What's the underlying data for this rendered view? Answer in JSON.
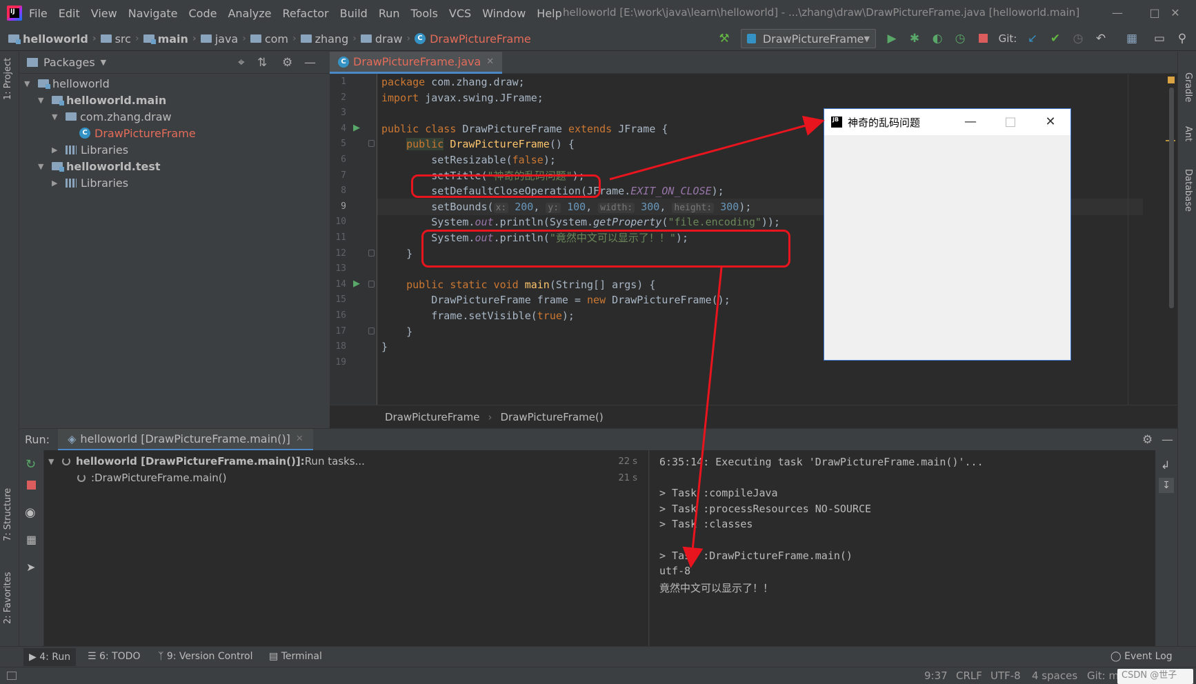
{
  "app": {
    "logo_text": "IJ",
    "menu": [
      "File",
      "Edit",
      "View",
      "Navigate",
      "Code",
      "Analyze",
      "Refactor",
      "Build",
      "Run",
      "Tools",
      "VCS",
      "Window",
      "Help"
    ],
    "window_title": "helloworld [E:\\work\\java\\learn\\helloworld] - ...\\zhang\\draw\\DrawPictureFrame.java [helloworld.main]",
    "window_controls": {
      "minimize": "—",
      "maximize": "□",
      "close": "✕"
    }
  },
  "breadcrumbs": [
    {
      "label": "helloworld",
      "icon": "module-folder-icon",
      "bold": true
    },
    {
      "label": "src",
      "icon": "folder-icon"
    },
    {
      "label": "main",
      "icon": "module-folder-icon",
      "bold": true
    },
    {
      "label": "java",
      "icon": "folder-icon"
    },
    {
      "label": "com",
      "icon": "folder-icon"
    },
    {
      "label": "zhang",
      "icon": "folder-icon"
    },
    {
      "label": "draw",
      "icon": "folder-icon"
    },
    {
      "label": "DrawPictureFrame",
      "icon": "class-icon",
      "accent": "#e46c5a"
    }
  ],
  "toolbar": {
    "run_config": "DrawPictureFrame",
    "git_label": "Git:",
    "icons": [
      "hammer-icon",
      "run-icon",
      "debug-icon",
      "coverage-icon",
      "profile-icon",
      "stop-icon",
      "git-update-icon",
      "git-commit-icon",
      "history-icon",
      "rollback-icon",
      "project-structure-icon",
      "terminal-icon",
      "search-icon"
    ]
  },
  "left_strip": {
    "project_tab": "1: Project",
    "structure_tab": "7: Structure",
    "favorites_tab": "2: Favorites"
  },
  "right_strip": {
    "gradle_tab": "Gradle",
    "ant_tab": "Ant",
    "database_tab": "Database"
  },
  "project": {
    "view_selector": "Packages",
    "tree": [
      {
        "label": "helloworld",
        "depth": 0,
        "expanded": true,
        "icon": "module-icon"
      },
      {
        "label": "helloworld.main",
        "depth": 1,
        "expanded": true,
        "icon": "module-icon",
        "bold": true
      },
      {
        "label": "com.zhang.draw",
        "depth": 2,
        "expanded": true,
        "icon": "package-icon"
      },
      {
        "label": "DrawPictureFrame",
        "depth": 3,
        "icon": "class-icon",
        "accent": "#e46c5a"
      },
      {
        "label": "Libraries",
        "depth": 2,
        "expanded": false,
        "icon": "libraries-icon"
      },
      {
        "label": "helloworld.test",
        "depth": 1,
        "expanded": true,
        "icon": "module-icon",
        "bold": true
      },
      {
        "label": "Libraries",
        "depth": 2,
        "expanded": false,
        "icon": "libraries-icon"
      }
    ]
  },
  "editor": {
    "tab_label": "DrawPictureFrame.java",
    "current_line": 9,
    "lines": [
      [
        [
          "kw",
          "package "
        ],
        [
          "",
          "com.zhang.draw;"
        ]
      ],
      [
        [
          "kw",
          "import "
        ],
        [
          "",
          "javax.swing.JFrame;"
        ]
      ],
      [],
      [
        [
          "kw",
          "public class "
        ],
        [
          "",
          "DrawPictureFrame "
        ],
        [
          "kw",
          "extends "
        ],
        [
          "",
          "JFrame {"
        ]
      ],
      [
        [
          "",
          "    "
        ],
        [
          "hlkw",
          "public"
        ],
        [
          "",
          " "
        ],
        [
          "mth",
          "DrawPictureFrame"
        ],
        [
          "",
          "() {"
        ]
      ],
      [
        [
          "",
          "        setResizable("
        ],
        [
          "kw",
          "false"
        ],
        [
          "",
          ");"
        ]
      ],
      [
        [
          "",
          "        setTitle("
        ],
        [
          "str",
          "\"神奇的乱码问题\""
        ],
        [
          "",
          ");"
        ]
      ],
      [
        [
          "",
          "        setDefaultCloseOperation(JFrame."
        ],
        [
          "fld",
          "EXIT_ON_CLOSE"
        ],
        [
          "",
          ");"
        ]
      ],
      [
        [
          "",
          "        setBounds("
        ],
        [
          "hint",
          "x:"
        ],
        [
          "num",
          " 200"
        ],
        [
          "",
          ", "
        ],
        [
          "hint",
          "y:"
        ],
        [
          "num",
          " 100"
        ],
        [
          "",
          ", "
        ],
        [
          "hint",
          "width:"
        ],
        [
          "num",
          " 300"
        ],
        [
          "",
          ", "
        ],
        [
          "hint",
          "height:"
        ],
        [
          "num",
          " 300"
        ],
        [
          "",
          ");"
        ]
      ],
      [
        [
          "",
          "        System."
        ],
        [
          "fld",
          "out"
        ],
        [
          "",
          ".println(System."
        ],
        [
          "fldi",
          "getProperty"
        ],
        [
          "",
          "("
        ],
        [
          "str",
          "\"file.encoding\""
        ],
        [
          "",
          "));"
        ]
      ],
      [
        [
          "",
          "        System."
        ],
        [
          "fld",
          "out"
        ],
        [
          "",
          ".println("
        ],
        [
          "str",
          "\"竟然中文可以显示了！！\""
        ],
        [
          "",
          ");"
        ]
      ],
      [
        [
          "",
          "    }"
        ]
      ],
      [],
      [
        [
          "",
          "    "
        ],
        [
          "kw",
          "public static void "
        ],
        [
          "mth",
          "main"
        ],
        [
          "",
          "(String[] args) {"
        ]
      ],
      [
        [
          "",
          "        DrawPictureFrame frame = "
        ],
        [
          "kw",
          "new "
        ],
        [
          "",
          "DrawPictureFrame();"
        ]
      ],
      [
        [
          "",
          "        frame.setVisible("
        ],
        [
          "kw",
          "true"
        ],
        [
          "",
          ");"
        ]
      ],
      [
        [
          "",
          "    }"
        ]
      ],
      [
        [
          "",
          "}"
        ]
      ],
      []
    ],
    "breadcrumb": [
      "DrawPictureFrame",
      "DrawPictureFrame()"
    ]
  },
  "run_panel": {
    "label": "Run:",
    "tab": "helloworld [DrawPictureFrame.main()]",
    "tree": [
      {
        "bold": "helloworld [DrawPictureFrame.main()]:",
        "text": " Run tasks...",
        "time": "22 s"
      },
      {
        "bold": "",
        "text": ":DrawPictureFrame.main()",
        "time": "21 s"
      }
    ],
    "console": [
      "6:35:14: Executing task 'DrawPictureFrame.main()'...",
      "",
      "> Task :compileJava",
      "> Task :processResources NO-SOURCE",
      "> Task :classes",
      "",
      "> Task :DrawPictureFrame.main()",
      "utf-8",
      "竟然中文可以显示了！！"
    ]
  },
  "bottom_tabs": [
    {
      "label": "4: Run",
      "icon": "run-icon",
      "active": true
    },
    {
      "label": "6: TODO",
      "icon": "todo-icon"
    },
    {
      "label": "9: Version Control",
      "icon": "vcs-icon"
    },
    {
      "label": "Terminal",
      "icon": "terminal-icon"
    }
  ],
  "event_log": "Event Log",
  "status": {
    "position": "9:37",
    "line_sep": "CRLF",
    "encoding": "UTF-8",
    "indent": "4 spaces",
    "git": "Git: master",
    "watermark": "CSDN @世子"
  },
  "swing_window": {
    "jb_badge": "JB",
    "title": "神奇的乱码问题",
    "min": "—",
    "max": "□",
    "close": "✕"
  },
  "colors": {
    "accent_red": "#e8141e",
    "class_file": "#e46c5a",
    "tab_underline": "#4a88c7"
  }
}
